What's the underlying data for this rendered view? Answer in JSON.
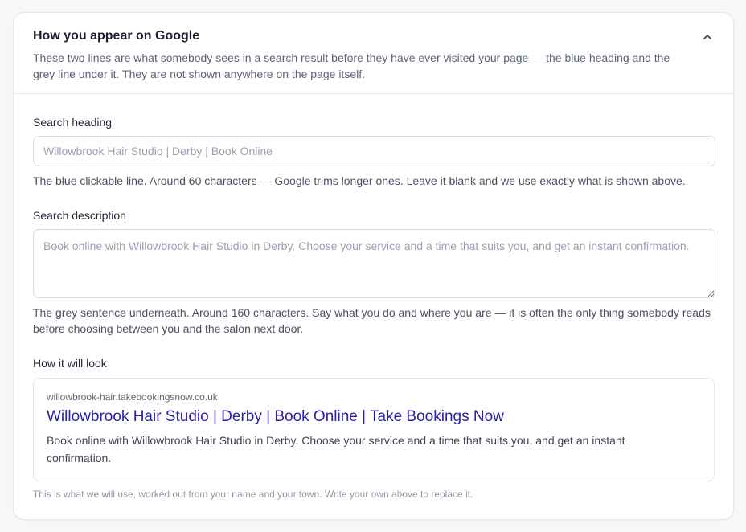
{
  "section": {
    "title": "How you appear on Google",
    "description": "These two lines are what somebody sees in a search result before they have ever visited your page — the blue heading and the grey line under it. They are not shown anywhere on the page itself.",
    "collapse_icon": "chevron-up-icon"
  },
  "search_heading": {
    "label": "Search heading",
    "value": "",
    "placeholder": "Willowbrook Hair Studio | Derby | Book Online",
    "help": "The blue clickable line. Around 60 characters — Google trims longer ones. Leave it blank and we use exactly what is shown above."
  },
  "search_description": {
    "label": "Search description",
    "value": "",
    "placeholder": "Book online with Willowbrook Hair Studio in Derby. Choose your service and a time that suits you, and get an instant confirmation.",
    "help": "The grey sentence underneath. Around 160 characters. Say what you do and where you are — it is often the only thing somebody reads before choosing between you and the salon next door."
  },
  "preview": {
    "label": "How it will look",
    "url": "willowbrook-hair.takebookingsnow.co.uk",
    "title": "Willowbrook Hair Studio | Derby | Book Online | Take Bookings Now",
    "description": "Book online with Willowbrook Hair Studio in Derby. Choose your service and a time that suits you, and get an instant confirmation.",
    "footnote": "This is what we will use, worked out from your name and your town. Write your own above to replace it."
  },
  "colors": {
    "link_title": "#2a1fa6",
    "muted_text": "#5b6478",
    "border": "#d7dbe3"
  }
}
